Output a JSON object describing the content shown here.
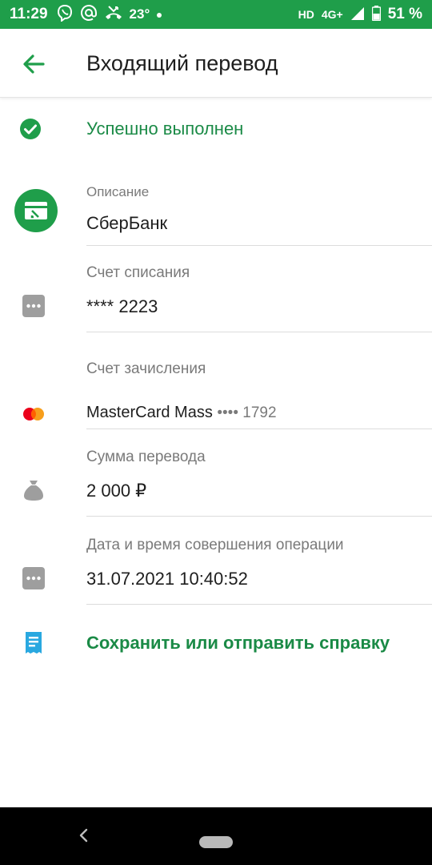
{
  "status_bar": {
    "time": "11:29",
    "temp": "23°",
    "network": "HD",
    "signal_label": "4G+",
    "battery": "51 %"
  },
  "header": {
    "title": "Входящий перевод"
  },
  "status": {
    "text": "Успешно выполнен"
  },
  "fields": [
    {
      "label": "Описание",
      "value": "СберБанк"
    },
    {
      "label": "Счет списания",
      "value": "**** 2223"
    },
    {
      "label": "Счет зачисления",
      "value": "MasterCard Mass",
      "masked": "•••• 1792"
    },
    {
      "label": "Сумма перевода",
      "value": "2 000 ₽"
    },
    {
      "label": "Дата и время совершения операции",
      "value": "31.07.2021 10:40:52"
    }
  ],
  "action": {
    "label": "Сохранить или отправить справку"
  },
  "colors": {
    "accent": "#1f9e4a",
    "accent_text": "#1a8a46",
    "icon_gray": "#9e9e9e",
    "mc_red": "#eb001b",
    "mc_orange": "#f79e1b",
    "doc_blue": "#29a8e0"
  }
}
